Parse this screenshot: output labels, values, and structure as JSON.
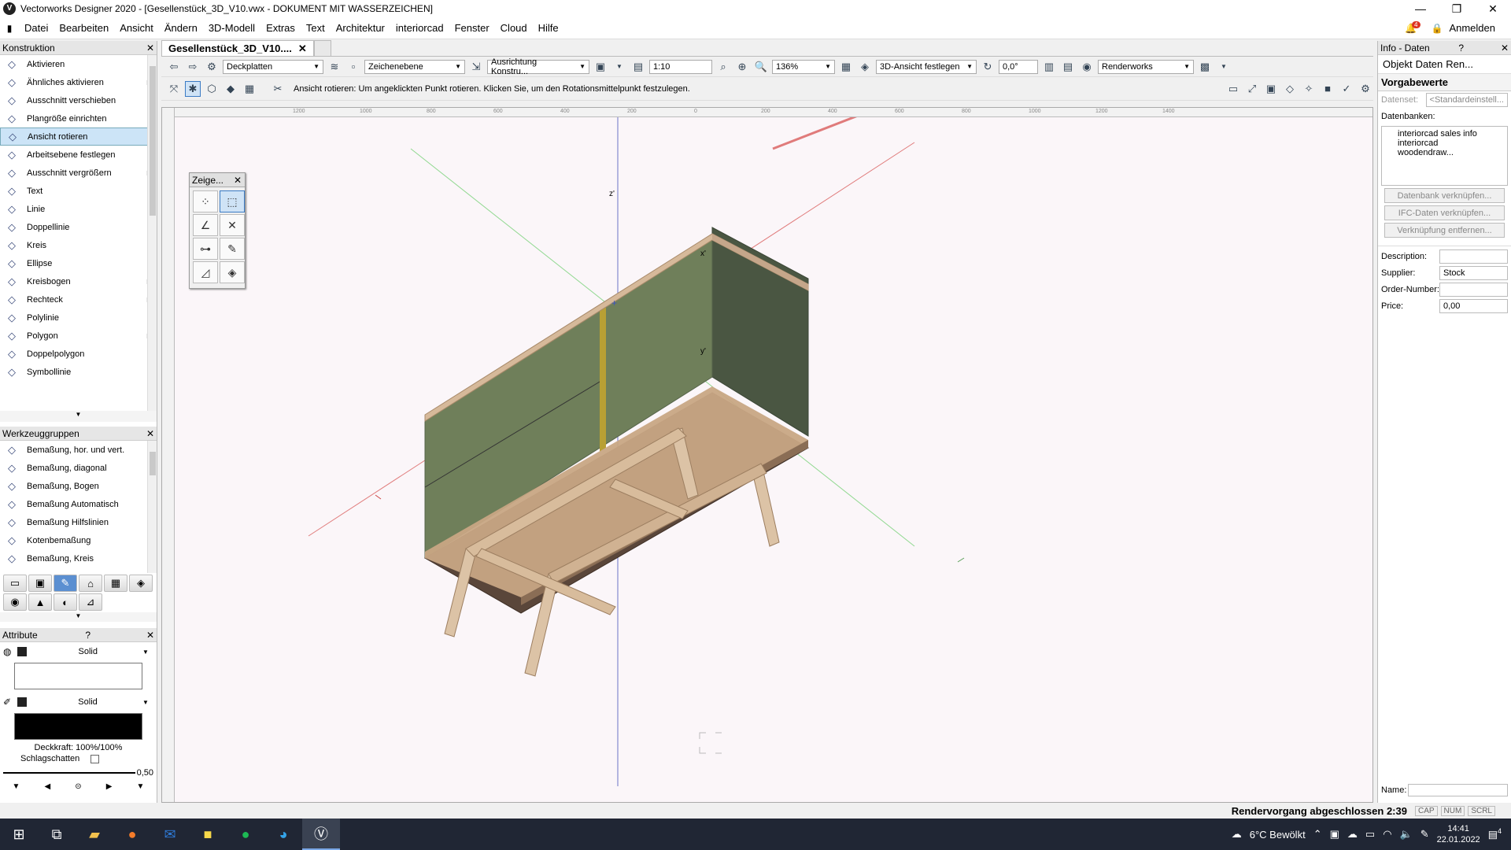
{
  "window": {
    "title": "Vectorworks Designer 2020 - [Gesellenstück_3D_V10.vwx - DOKUMENT MIT WASSERZEICHEN]",
    "minimize": "—",
    "maximize": "❐",
    "close": "✕"
  },
  "menu": [
    "Datei",
    "Bearbeiten",
    "Ansicht",
    "Ändern",
    "3D-Modell",
    "Extras",
    "Text",
    "Architektur",
    "interiorcad",
    "Fenster",
    "Cloud",
    "Hilfe"
  ],
  "account": {
    "notify_count": "4",
    "login": "Anmelden"
  },
  "construction": {
    "title": "Konstruktion",
    "tools": [
      {
        "label": "Aktivieren",
        "icon": "arrow-pointer-icon"
      },
      {
        "label": "Ähnliches aktivieren",
        "icon": "wand-icon",
        "submenu": true
      },
      {
        "label": "Ausschnitt verschieben",
        "icon": "hand-icon"
      },
      {
        "label": "Plangröße einrichten",
        "icon": "page-setup-icon"
      },
      {
        "label": "Ansicht rotieren",
        "icon": "rotate-view-icon",
        "selected": true
      },
      {
        "label": "Arbeitsebene festlegen",
        "icon": "working-plane-icon"
      },
      {
        "label": "Ausschnitt vergrößern",
        "icon": "zoom-icon",
        "submenu": true
      },
      {
        "label": "Text",
        "icon": "text-icon"
      },
      {
        "label": "Linie",
        "icon": "line-icon"
      },
      {
        "label": "Doppellinie",
        "icon": "double-line-icon"
      },
      {
        "label": "Kreis",
        "icon": "circle-icon"
      },
      {
        "label": "Ellipse",
        "icon": "ellipse-icon"
      },
      {
        "label": "Kreisbogen",
        "icon": "arc-icon",
        "submenu": true
      },
      {
        "label": "Rechteck",
        "icon": "rectangle-icon",
        "submenu": true
      },
      {
        "label": "Polylinie",
        "icon": "polyline-icon"
      },
      {
        "label": "Polygon",
        "icon": "polygon-icon",
        "submenu": true
      },
      {
        "label": "Doppelpolygon",
        "icon": "double-polygon-icon"
      },
      {
        "label": "Symbollinie",
        "icon": "symbol-line-icon"
      }
    ]
  },
  "toolsets": {
    "title": "Werkzeuggruppen",
    "tools": [
      {
        "label": "Bemaßung, hor. und vert.",
        "icon": "dimension-hv-icon"
      },
      {
        "label": "Bemaßung, diagonal",
        "icon": "dimension-diagonal-icon"
      },
      {
        "label": "Bemaßung, Bogen",
        "icon": "dimension-arc-icon"
      },
      {
        "label": "Bemaßung Automatisch",
        "icon": "dimension-auto-icon"
      },
      {
        "label": "Bemaßung Hilfslinien",
        "icon": "dimension-guides-icon"
      },
      {
        "label": "Kotenbemaßung",
        "icon": "elevation-dimension-icon"
      },
      {
        "label": "Bemaßung, Kreis",
        "icon": "dimension-circle-icon"
      }
    ]
  },
  "attributes": {
    "title": "Attribute",
    "fill_style": "Solid",
    "pen_style": "Solid",
    "opacity": "Deckkraft: 100%/100%",
    "shadow": "Schlagschatten",
    "line_weight": "0,50"
  },
  "document": {
    "tab": "Gesellenstück_3D_V10....",
    "class": "Deckplatten",
    "layer": "Zeichenebene",
    "alignment": "Ausrichtung Konstru...",
    "scale": "1:10",
    "zoom": "136%",
    "view": "3D-Ansicht festlegen",
    "rotation": "0,0°",
    "render": "Renderworks",
    "hint": "Ansicht rotieren: Um angeklickten Punkt rotieren. Klicken Sie, um den Rotationsmittelpunkt festzulegen."
  },
  "floating_palette": {
    "title": "Zeige..."
  },
  "ruler_top": [
    "1200",
    "1000",
    "800",
    "600",
    "400",
    "200",
    "0",
    "200",
    "400",
    "600",
    "800",
    "1000",
    "1200",
    "1400"
  ],
  "axis_labels": {
    "z": "z'",
    "x": "x'",
    "y": "y'"
  },
  "colors": {
    "panel_green": "#6f7f5a",
    "panel_green_dark": "#4a5642",
    "wood_light": "#d6b99a",
    "wood_dark": "#5a463a",
    "accent_selected": "#cce4f7"
  },
  "info": {
    "title": "Info - Daten",
    "tabs": [
      "Objekt",
      "Daten",
      "Ren..."
    ],
    "section": "Vorgabewerte",
    "dataset_label": "Datenset:",
    "dataset_value": "<Standardeinstell...",
    "databases_label": "Datenbanken:",
    "databases": [
      "interiorcad sales info",
      "interiorcad woodendraw..."
    ],
    "buttons": [
      "Datenbank verknüpfen...",
      "IFC-Daten verknüpfen...",
      "Verknüpfung entfernen..."
    ],
    "fields": [
      {
        "label": "Description:",
        "value": ""
      },
      {
        "label": "Supplier:",
        "value": "Stock"
      },
      {
        "label": "Order-Number:",
        "value": ""
      },
      {
        "label": "Price:",
        "value": "0,00"
      }
    ],
    "name_label": "Name:"
  },
  "status": {
    "message": "Rendervorgang abgeschlossen 2:39",
    "keys": [
      "CAP",
      "NUM",
      "SCRL"
    ]
  },
  "taskbar": {
    "weather": "6°C  Bewölkt",
    "time": "14:41",
    "date": "22.01.2022",
    "notifications": "4"
  }
}
